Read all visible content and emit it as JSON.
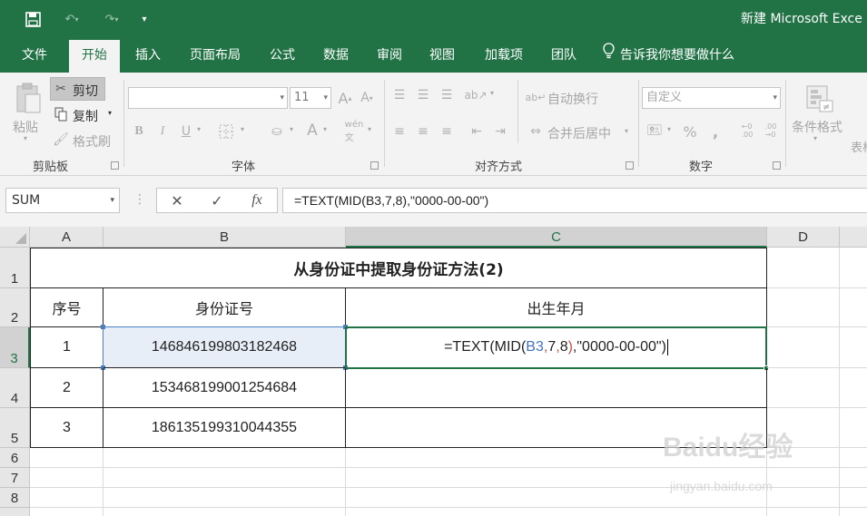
{
  "window": {
    "title": "新建 Microsoft Exce"
  },
  "tabs": [
    {
      "label": "文件"
    },
    {
      "label": "开始"
    },
    {
      "label": "插入"
    },
    {
      "label": "页面布局"
    },
    {
      "label": "公式"
    },
    {
      "label": "数据"
    },
    {
      "label": "审阅"
    },
    {
      "label": "视图"
    },
    {
      "label": "加载项"
    },
    {
      "label": "团队"
    }
  ],
  "active_tab": "开始",
  "tell_me": "告诉我你想要做什么",
  "ribbon": {
    "clipboard": {
      "label": "剪贴板",
      "paste": "粘贴",
      "cut": "剪切",
      "copy": "复制",
      "format_painter": "格式刷"
    },
    "font": {
      "label": "字体",
      "font_name": "",
      "font_size": "11"
    },
    "alignment": {
      "label": "对齐方式",
      "wrap": "自动换行",
      "merge": "合并后居中"
    },
    "number": {
      "label": "数字",
      "format": "自定义"
    },
    "styles": {
      "conditional": "条件格式",
      "table": "表格"
    }
  },
  "formula_bar": {
    "name_box": "SUM",
    "fx": "fx",
    "formula": "=TEXT(MID(B3,7,8),\"0000-00-00\")"
  },
  "columns": [
    "A",
    "B",
    "C",
    "D"
  ],
  "selected_column": "C",
  "rows": [
    "1",
    "2",
    "3",
    "4",
    "5",
    "6",
    "7",
    "8"
  ],
  "selected_row": "3",
  "sheet": {
    "title": "从身份证中提取身份证方法(2)",
    "headers": [
      "序号",
      "身份证号",
      "出生年月"
    ],
    "data": [
      {
        "no": "1",
        "id": "146846199803182468"
      },
      {
        "no": "2",
        "id": "153468199001254684"
      },
      {
        "no": "3",
        "id": "186135199310044355"
      }
    ],
    "editing_cell": {
      "p1": "=TEXT(MID(",
      "ref": "B3",
      "c1": ",",
      "p2": "7",
      "c2": ",",
      "p3": "8",
      "c3": ")",
      "c4": ",",
      "p4": "\"0000-00-00\")"
    }
  },
  "watermark": {
    "text": "Baidu经验",
    "url": "jingyan.baidu.com"
  }
}
